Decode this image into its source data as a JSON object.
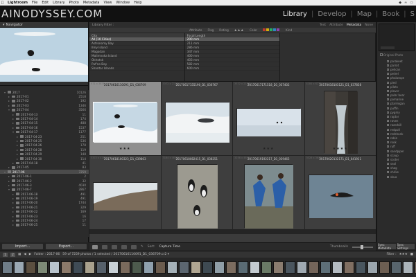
{
  "menubar": {
    "app": "Lightroom",
    "items": [
      "File",
      "Edit",
      "Library",
      "Photo",
      "Metadata",
      "View",
      "Window",
      "Help"
    ]
  },
  "identity": {
    "logo": "AINODYSSEY.COM",
    "modules": [
      "Library",
      "Develop",
      "Map",
      "Book",
      "S"
    ],
    "active_module": "Library"
  },
  "left": {
    "navigator_title": "Navigator",
    "folders": [
      {
        "name": "2017",
        "count": "10126",
        "level": 0,
        "open": true
      },
      {
        "name": "2017-01",
        "count": "2518",
        "level": 1
      },
      {
        "name": "2017-02",
        "count": "192",
        "level": 1
      },
      {
        "name": "2017-03",
        "count": "1346",
        "level": 1
      },
      {
        "name": "2017-04",
        "count": "3566",
        "level": 1,
        "open": true
      },
      {
        "name": "2017-04-13",
        "count": "11",
        "level": 2
      },
      {
        "name": "2017-04-14",
        "count": "174",
        "level": 2
      },
      {
        "name": "2017-04-15",
        "count": "488",
        "level": 2
      },
      {
        "name": "2017-04-16",
        "count": "1537",
        "level": 2
      },
      {
        "name": "2017-04-17",
        "count": "1177",
        "level": 2,
        "open": true
      },
      {
        "name": "2017-04-23",
        "count": "251",
        "level": 3
      },
      {
        "name": "2017-04-25",
        "count": "536",
        "level": 3
      },
      {
        "name": "2017-04-26",
        "count": "178",
        "level": 3
      },
      {
        "name": "2017-04-28",
        "count": "119",
        "level": 3
      },
      {
        "name": "2017-04-29",
        "count": "148",
        "level": 3
      },
      {
        "name": "2017-04-30",
        "count": "114",
        "level": 3
      },
      {
        "name": "2017-04-18",
        "count": "41",
        "level": 2
      },
      {
        "name": "2017-05",
        "count": "83",
        "level": 1
      },
      {
        "name": "2017-06",
        "count": "7259",
        "level": 0,
        "open": true,
        "selected": true
      },
      {
        "name": "2017-06-1",
        "count": "2",
        "level": 1
      },
      {
        "name": "2017-06-2",
        "count": "32",
        "level": 1
      },
      {
        "name": "2017-06-3",
        "count": "4030",
        "level": 1
      },
      {
        "name": "2017-06-7",
        "count": "2867",
        "level": 1,
        "open": true
      },
      {
        "name": "2017-06-18",
        "count": "491",
        "level": 2
      },
      {
        "name": "2017-06-19",
        "count": "491",
        "level": 2
      },
      {
        "name": "2017-06-20",
        "count": "1744",
        "level": 2
      },
      {
        "name": "2017-06-21",
        "count": "329",
        "level": 2
      },
      {
        "name": "2017-06-22",
        "count": "169",
        "level": 2
      },
      {
        "name": "2017-06-23",
        "count": "16",
        "level": 2
      },
      {
        "name": "2017-06-24",
        "count": "17",
        "level": 2
      },
      {
        "name": "2017-06-25",
        "count": "11",
        "level": 2
      }
    ],
    "import_label": "Import...",
    "export_label": "Export..."
  },
  "filter": {
    "title": "Library Filter :",
    "tabs": [
      "Text",
      "Attribute",
      "Metadata",
      "None"
    ],
    "active_tab": "Metadata",
    "attribute_label": "Attribute",
    "flag_label": "Flag",
    "rating_label": "Rating",
    "rating_stars": "★★★",
    "color_label": "Color",
    "kind_label": "Kind",
    "color_swatches": [
      "#c0392b",
      "#d4ac0d",
      "#27ae60",
      "#2e86c1",
      "#8e44ad"
    ]
  },
  "columns": [
    {
      "header": "City",
      "rows": [
        "All (10 Cities)",
        "Astronomy Bay",
        "Ilmy Island",
        "Magadan",
        "Malimnoka Island",
        "Okhotsk",
        "Puf'no Bay",
        "Shantar Islands"
      ],
      "selected": 0
    },
    {
      "header": "Focal Length",
      "rows": [
        "200 mm",
        "211 mm",
        "286 mm",
        "347 mm",
        "400 mm",
        "403 mm",
        "582 mm",
        "600 mm"
      ],
      "selected": 0
    }
  ],
  "grid": [
    {
      "index": "571 x 3876",
      "filename": "20170616110091_D1_036709",
      "stars": "★★★",
      "selected": true,
      "thumb": "ice-birds"
    },
    {
      "index": "3372 x 2126",
      "filename": "20170617155190_D1_036767",
      "stars": "",
      "thumb": "ice-seal"
    },
    {
      "index": "3372 x 2186",
      "filename": "20170617171518_D1_037402",
      "stars": "★★★",
      "thumb": "sea-birds"
    },
    {
      "index": "4184 x 6272",
      "filename": "20170618103121_D1_037858",
      "stars": "★★★★",
      "thumb": "rock-arch"
    },
    {
      "index": "3372 x 4164",
      "filename": "20170618100323_D1_039863",
      "stars": "",
      "thumb": "cliff"
    },
    {
      "index": "3164 x 4616",
      "filename": "20170618082415_D1_038251",
      "stars": "",
      "thumb": "puffins"
    },
    {
      "index": "3256 x 4611",
      "filename": "20170619192217_D1_039465",
      "stars": "",
      "thumb": "dancers"
    },
    {
      "index": "3328 x 3640",
      "filename": "20170620132171_D1_041911",
      "stars": "",
      "thumb": "puffin-flight"
    }
  ],
  "toolbar": {
    "sort_label": "Sort:",
    "sort_value": "Capture Time",
    "thumbnails_label": "Thumbnails"
  },
  "right": {
    "keywords": [
      "parakeet",
      "parrot",
      "pelican",
      "petrel",
      "phalarope",
      "pied",
      "pilots",
      "plover",
      "polar bear",
      "pomarine",
      "ptarmigan",
      "puffin",
      "pygmy",
      "raptor",
      "raven",
      "razorbill",
      "redpoll",
      "redshank",
      "robin",
      "rook",
      "ruff",
      "sandpiper",
      "scaup",
      "scoter",
      "seal",
      "shag",
      "shrike",
      "skua"
    ],
    "original_photo_label": "Original Photo",
    "sync_label": "Sync Metadata",
    "sync2_label": "Sync Settings"
  },
  "filmbar": {
    "page_a": "1",
    "page_b": "2",
    "folder_text": "Folder : 2017-06",
    "count_text": "59 of 7259 photos / 1 selected / 20170616110091_D1_036709.cr2 ▾",
    "filter_label": "Filter :",
    "filter_stars": "★★★"
  },
  "filmstrip_colors": [
    "#6f7d88",
    "#9aa8b3",
    "#5b4f40",
    "#7d8a77",
    "#b8c3cc",
    "#8c7a6a",
    "#3f4b55",
    "#a9a18d",
    "#56606a",
    "#c9d1d6",
    "#7a6a5c",
    "#4d5a4d",
    "#8fa0ad",
    "#6b5c4e",
    "#a6b2b9",
    "#5c6670",
    "#b0a692",
    "#3e4a52",
    "#909fa8",
    "#7c6d60",
    "#5a6b74",
    "#c4cbd0",
    "#6a7a66",
    "#8a7c6f",
    "#4a555e",
    "#a0aab2",
    "#74655a",
    "#5e6f78",
    "#b5bcc2",
    "#806f62",
    "#49565f",
    "#9ba6ae",
    "#6c5e52",
    "#58656d",
    "#aab3b9",
    "#7f7064",
    "#4c5861"
  ]
}
